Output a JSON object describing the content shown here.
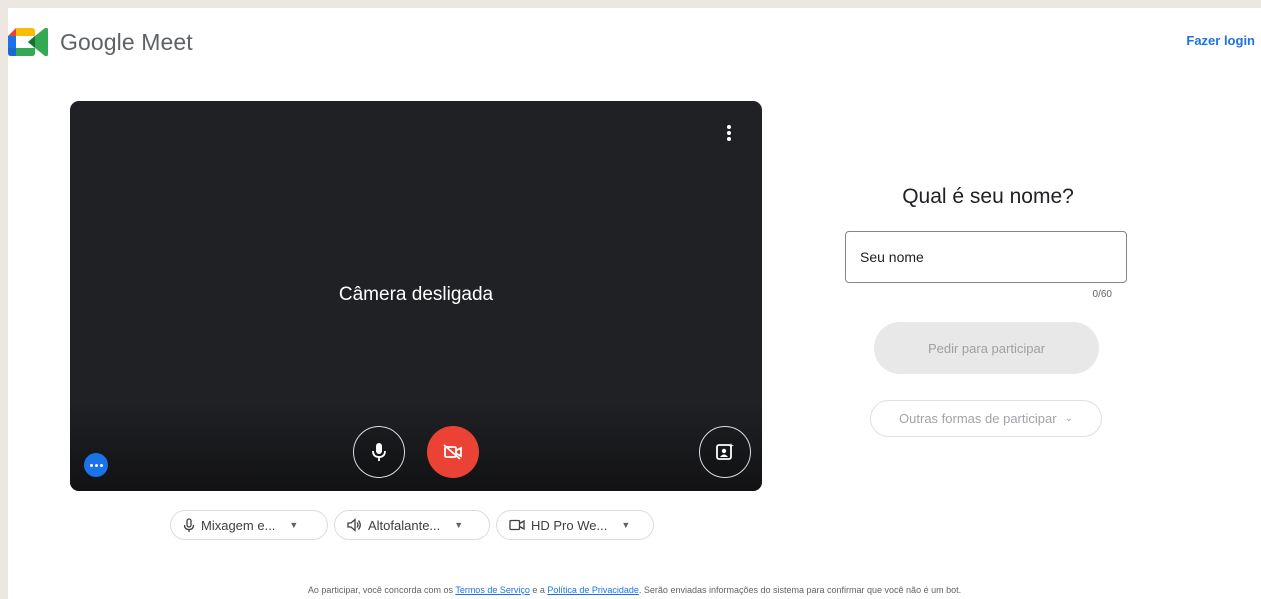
{
  "header": {
    "app_name": "Google Meet",
    "login_label": "Fazer login"
  },
  "preview": {
    "camera_status": "Câmera desligada",
    "icons": {
      "menu": "more-vert-icon",
      "microphone": "mic-icon",
      "camera": "videocam-off-icon",
      "effects": "visual-effects-icon",
      "more_options": "more-horiz-icon"
    }
  },
  "devices": {
    "microphone": "Mixagem e...",
    "speaker": "Altofalante...",
    "camera": "HD Pro We..."
  },
  "join": {
    "prompt": "Qual é seu nome?",
    "name_placeholder": "Seu nome",
    "name_value": "",
    "char_count": "0/60",
    "ask_to_join_label": "Pedir para participar",
    "other_ways_label": "Outras formas de participar"
  },
  "footer": {
    "text_before": "Ao participar, você concorda com os ",
    "terms_link": "Termos de Serviço",
    "text_mid": " e a ",
    "privacy_link": "Política de Privacidade",
    "text_after": ". Serão enviadas informações do sistema para confirmar que você não é um bot."
  },
  "colors": {
    "accent": "#1a73e8",
    "camera_off_red": "#ea4335",
    "preview_bg": "#202124",
    "disabled_button_bg": "#e8e8e8"
  }
}
